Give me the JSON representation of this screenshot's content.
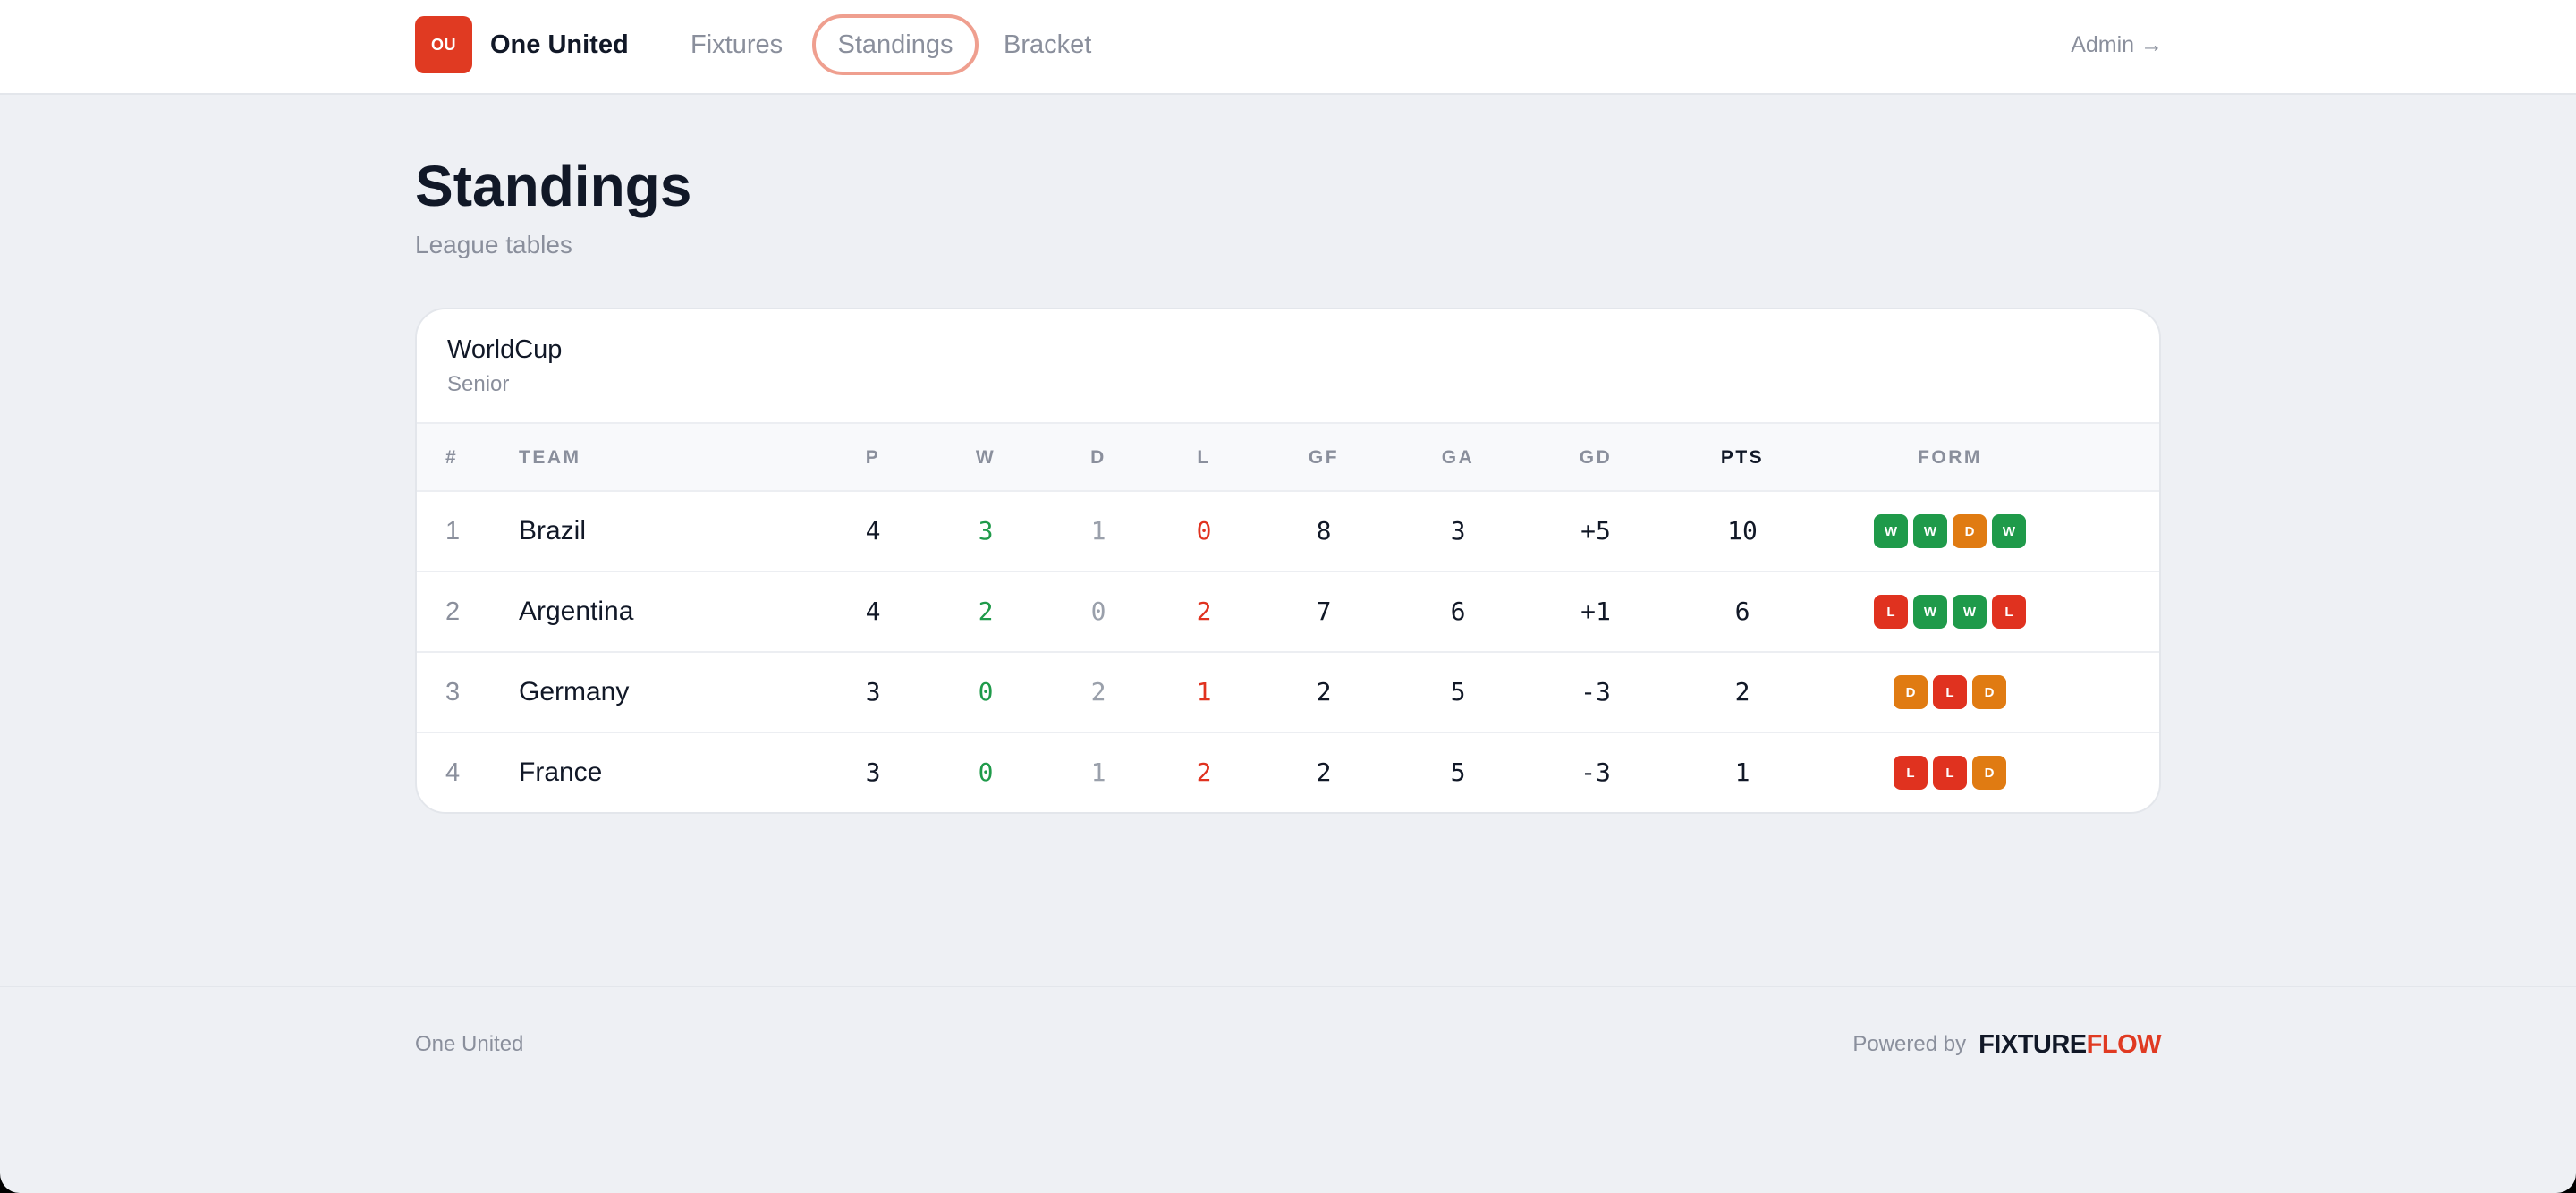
{
  "header": {
    "logo_text": "OU",
    "brand": "One United",
    "nav": [
      "Fixtures",
      "Standings",
      "Bracket"
    ],
    "active_nav": "Standings",
    "admin": "Admin →"
  },
  "page": {
    "title": "Standings",
    "subtitle": "League tables"
  },
  "league": {
    "name": "WorldCup",
    "category": "Senior",
    "columns": [
      "#",
      "TEAM",
      "P",
      "W",
      "D",
      "L",
      "GF",
      "GA",
      "GD",
      "PTS",
      "FORM"
    ],
    "rows": [
      {
        "rank": "1",
        "team": "Brazil",
        "p": "4",
        "w": "3",
        "d": "1",
        "l": "0",
        "gf": "8",
        "ga": "3",
        "gd": "+5",
        "pts": "10",
        "form": [
          "W",
          "W",
          "D",
          "W"
        ]
      },
      {
        "rank": "2",
        "team": "Argentina",
        "p": "4",
        "w": "2",
        "d": "0",
        "l": "2",
        "gf": "7",
        "ga": "6",
        "gd": "+1",
        "pts": "6",
        "form": [
          "L",
          "W",
          "W",
          "L"
        ]
      },
      {
        "rank": "3",
        "team": "Germany",
        "p": "3",
        "w": "0",
        "d": "2",
        "l": "1",
        "gf": "2",
        "ga": "5",
        "gd": "-3",
        "pts": "2",
        "form": [
          "D",
          "L",
          "D"
        ]
      },
      {
        "rank": "4",
        "team": "France",
        "p": "3",
        "w": "0",
        "d": "1",
        "l": "2",
        "gf": "2",
        "ga": "5",
        "gd": "-3",
        "pts": "1",
        "form": [
          "L",
          "L",
          "D"
        ]
      }
    ]
  },
  "form_colors": {
    "W": "#1f9a4a",
    "D": "#e07b12",
    "L": "#e0321f"
  },
  "footer": {
    "left": "One United",
    "powered_by": "Powered by",
    "logo_part1": "FIXTURE",
    "logo_part2": "FLOW"
  }
}
